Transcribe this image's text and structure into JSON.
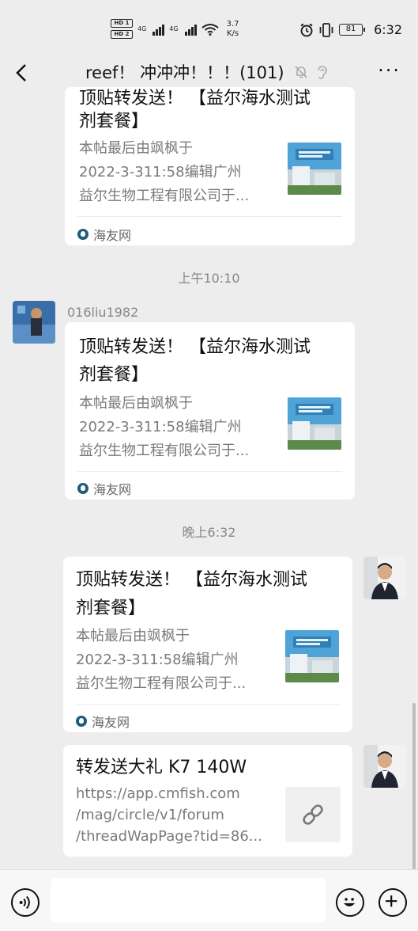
{
  "status_bar": {
    "hd1": "HD 1",
    "hd2": "HD 2",
    "net1": "4G",
    "net2": "4G",
    "speed_value": "3.7",
    "speed_unit": "K/s",
    "battery": "81",
    "time": "6:32",
    "icons": [
      "alarm-icon",
      "vibrate-icon",
      "battery-icon"
    ]
  },
  "header": {
    "back_icon": "chevron-left-icon",
    "title": "reef！ 冲冲冲！！！(101)",
    "muted_icon": "bell-off-icon",
    "ear_icon": "ear-icon",
    "more_label": "···"
  },
  "messages": [
    {
      "type": "card",
      "title_line1": "顶贴转发送！ 【益尔海水测试",
      "title_line2": "剂套餐】",
      "desc_line1": "本帖最后由飒枫于",
      "desc_line2": "2022-3-311:58编辑广州",
      "desc_line3": "益尔生物工程有限公司于...",
      "source": "海友网"
    },
    {
      "type": "timestamp",
      "text": "上午10:10"
    },
    {
      "type": "card",
      "sender": "016liu1982",
      "title_line1": "顶贴转发送！ 【益尔海水测试",
      "title_line2": "剂套餐】",
      "desc_line1": "本帖最后由飒枫于",
      "desc_line2": "2022-3-311:58编辑广州",
      "desc_line3": "益尔生物工程有限公司于...",
      "source": "海友网"
    },
    {
      "type": "timestamp",
      "text": "晚上6:32"
    },
    {
      "type": "card",
      "title_line1": "顶贴转发送！ 【益尔海水测试",
      "title_line2": "剂套餐】",
      "desc_line1": "本帖最后由飒枫于",
      "desc_line2": "2022-3-311:58编辑广州",
      "desc_line3": "益尔生物工程有限公司于...",
      "source": "海友网"
    },
    {
      "type": "link",
      "title": "转发送大礼 K7 140W",
      "url_line1": "https://app.cmfish.com",
      "url_line2": "/mag/circle/v1/forum",
      "url_line3": "/threadWapPage?tid=86...",
      "icon": "link-icon"
    }
  ],
  "input_bar": {
    "voice_icon": "voice-icon",
    "input_value": "",
    "emoji_icon": "emoji-icon",
    "plus_icon": "plus-icon"
  },
  "colors": {
    "background": "#ededed",
    "bubble": "#ffffff",
    "muted_text": "#888888"
  }
}
